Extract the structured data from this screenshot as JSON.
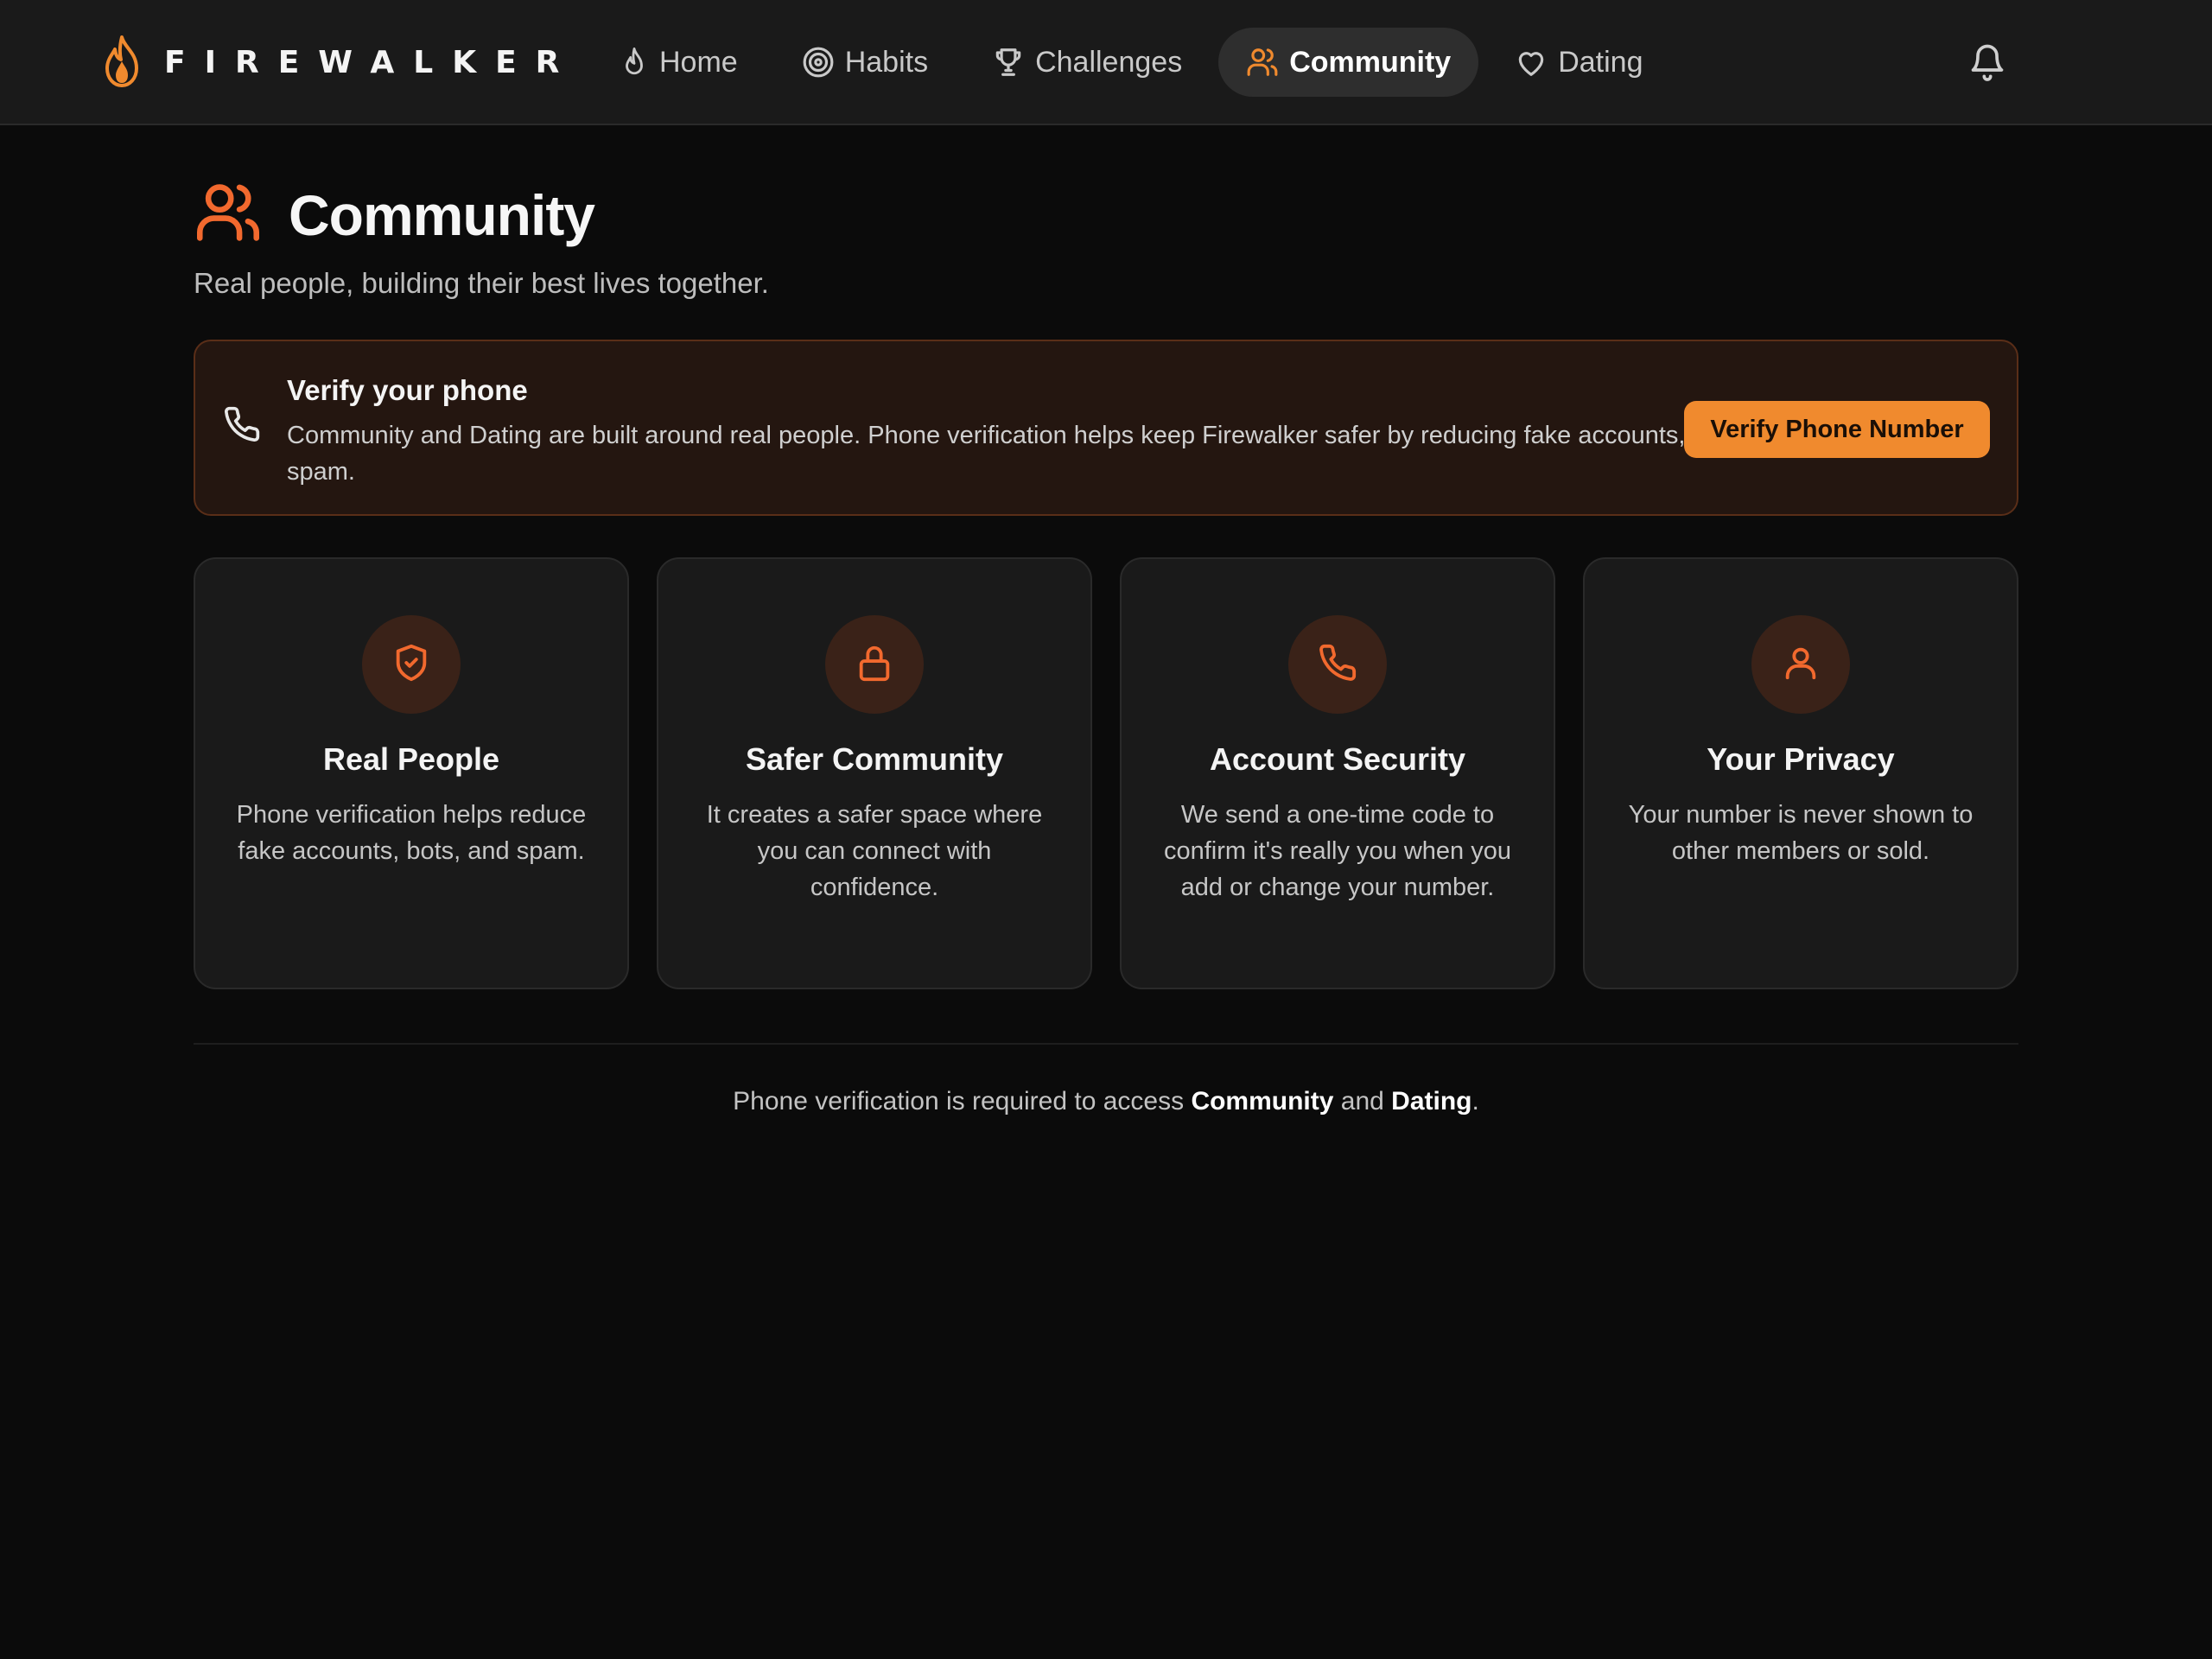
{
  "brand": {
    "name": "FIREWALKER",
    "accent": "#f08a2e"
  },
  "nav": {
    "items": [
      {
        "label": "Home",
        "icon": "flame-icon"
      },
      {
        "label": "Habits",
        "icon": "target-icon"
      },
      {
        "label": "Challenges",
        "icon": "trophy-icon"
      },
      {
        "label": "Community",
        "icon": "users-icon",
        "active": true
      },
      {
        "label": "Dating",
        "icon": "heart-icon"
      }
    ],
    "notifications_icon": "bell-icon"
  },
  "header": {
    "title": "Community",
    "subtitle": "Real people, building their best lives together."
  },
  "banner": {
    "title": "Verify your phone",
    "text": "Community and Dating are built around real people. Phone verification helps keep Firewalker safer by reducing fake accounts, bots, and spam.",
    "button_label": "Verify Phone Number"
  },
  "cards": [
    {
      "icon": "shield-check-icon",
      "title": "Real People",
      "text": "Phone verification helps reduce fake accounts, bots, and spam."
    },
    {
      "icon": "lock-icon",
      "title": "Safer Community",
      "text": "It creates a safer space where you can connect with confidence."
    },
    {
      "icon": "phone-icon",
      "title": "Account Security",
      "text": "We send a one-time code to confirm it's really you when you add or change your number."
    },
    {
      "icon": "user-icon",
      "title": "Your Privacy",
      "text": "Your number is never shown to other members or sold."
    }
  ],
  "footer": {
    "prefix": "Phone verification is required to access ",
    "community": "Community",
    "middle": " and ",
    "dating": "Dating",
    "suffix": "."
  }
}
